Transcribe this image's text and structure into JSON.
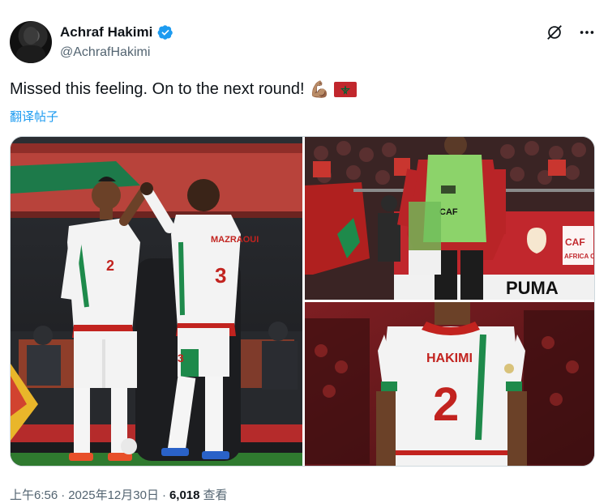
{
  "author": {
    "display_name": "Achraf Hakimi",
    "handle": "@AchrafHakimi",
    "verified": true
  },
  "icons": {
    "verified": "verified-badge-icon",
    "grok": "grok-icon",
    "more": "more-icon"
  },
  "tweet": {
    "text": "Missed this feeling. On to the next round!",
    "emoji_1": "💪🏽",
    "emoji_flag": "flag-morocco",
    "translate_label": "翻译帖子"
  },
  "media": {
    "shirt_number": "2",
    "shirt_name": "HAKIMI",
    "shirt_name_2": "MAZRAOUI",
    "shirt_number_3": "3",
    "bib_text": "CAF",
    "banner_caf": "CAF",
    "banner_africa": "AFRICA CUP",
    "banner_puma": "PUMA"
  },
  "meta": {
    "time": "上午6:56",
    "sep1": "·",
    "date": "2025年12月30日",
    "sep2": "·",
    "views_count": "6,018",
    "views_label": "查看"
  },
  "colors": {
    "accent": "#1d9bf0",
    "secondary_text": "#536471",
    "text": "#0f1419",
    "morocco_red": "#c1272d",
    "morocco_green": "#006233"
  }
}
